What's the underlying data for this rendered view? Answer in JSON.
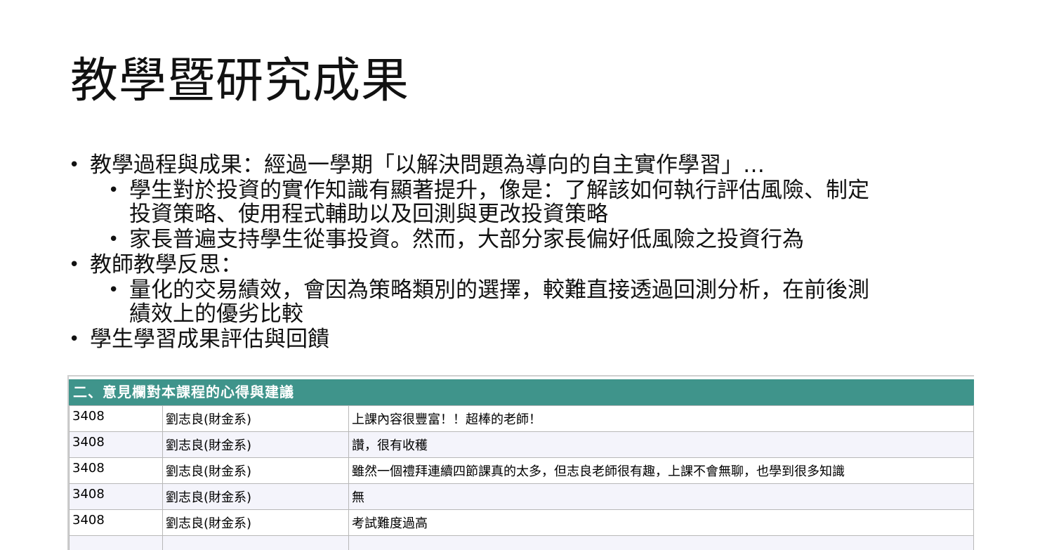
{
  "title": "教學暨研究成果",
  "bullets": {
    "b1": "教學過程與成果：經過一學期「以解決問題為導向的自主實作學習」…",
    "b1_sub1_line1": "學生對於投資的實作知識有顯著提升，像是：了解該如何執行評估風險、制定",
    "b1_sub1_line2": "投資策略、使用程式輔助以及回測與更改投資策略",
    "b1_sub2": "家長普遍支持學生從事投資。然而，大部分家長偏好低風險之投資行為",
    "b2": "教師教學反思：",
    "b2_sub1_line1": "量化的交易績效，會因為策略類別的選擇，較難直接透過回測分析，在前後測",
    "b2_sub1_line2": "績效上的優劣比較",
    "b3": "學生學習成果評估與回饋"
  },
  "panel": {
    "header": "二、意見欄對本課程的心得與建議",
    "rows": [
      {
        "code": "3408",
        "teacher": "劉志良(財金系)",
        "comment": "上課內容很豐富！！超棒的老師！"
      },
      {
        "code": "3408",
        "teacher": "劉志良(財金系)",
        "comment": "讚，很有收穫"
      },
      {
        "code": "3408",
        "teacher": "劉志良(財金系)",
        "comment": "雖然一個禮拜連續四節課真的太多，但志良老師很有趣，上課不會無聊，也學到很多知識"
      },
      {
        "code": "3408",
        "teacher": "劉志良(財金系)",
        "comment": "無"
      },
      {
        "code": "3408",
        "teacher": "劉志良(財金系)",
        "comment": "考試難度過高"
      }
    ]
  },
  "colors": {
    "header_bg": "#3f948b",
    "row_alt_bg": "#f4f4fb"
  }
}
